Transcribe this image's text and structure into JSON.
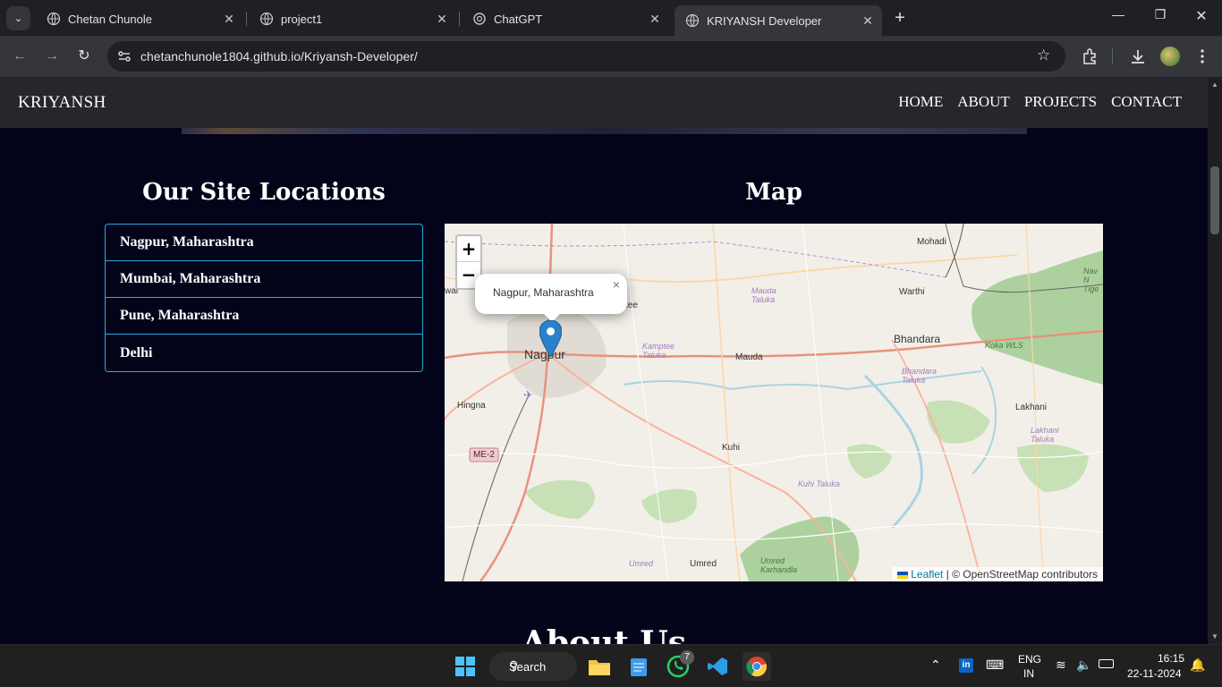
{
  "browser": {
    "tabs": [
      {
        "title": "Chetan Chunole",
        "active": false
      },
      {
        "title": "project1",
        "active": false
      },
      {
        "title": "ChatGPT",
        "active": false
      },
      {
        "title": "KRIYANSH Developer",
        "active": true
      }
    ],
    "url_host": "chetanchunole1804.github.io",
    "url_path": "/Kriyansh-Developer/"
  },
  "site": {
    "brand": "KRIYANSH",
    "nav": [
      "HOME",
      "ABOUT",
      "PROJECTS",
      "CONTACT"
    ]
  },
  "locations": {
    "heading": "Our Site Locations",
    "items": [
      "Nagpur, Maharashtra",
      "Mumbai, Maharashtra",
      "Pune, Maharashtra",
      "Delhi"
    ]
  },
  "map": {
    "heading": "Map",
    "zoom_in": "+",
    "zoom_out": "−",
    "popup_text": "Nagpur, Maharashtra",
    "popup_close": "×",
    "attribution_link": "Leaflet",
    "attribution_rest": "| © OpenStreetMap contributors",
    "labels": {
      "nagpur": "Nagpur",
      "bhandara": "Bhandara",
      "mohadi": "Mohadi",
      "warthi": "Warthi",
      "mauda": "Mauda",
      "mauda_taluka": "Mauda Taluka",
      "kamptee_taluka": "Kamptee Taluka",
      "hingna": "Hingna",
      "kuhi": "Kuhi",
      "kuhi_taluka": "Kuhi Taluka",
      "lakhani": "Lakhani",
      "lakhani_taluka": "Lakhani Taluka",
      "bhandara_taluka": "Bhandara Taluka",
      "koka": "Koka WLS",
      "umred": "Umred",
      "umred_italic": "Umred",
      "umred_karhandla": "Umred Karhandla",
      "me2": "ME-2",
      "war": "war",
      "tee": "tee",
      "nav_tiger": "Nav N Tige"
    }
  },
  "next_section_heading": "About Us",
  "taskbar": {
    "search_label": "Search",
    "whatsapp_badge": "7",
    "lang": "ENG",
    "region": "IN",
    "time": "16:15",
    "date": "22-11-2024"
  }
}
